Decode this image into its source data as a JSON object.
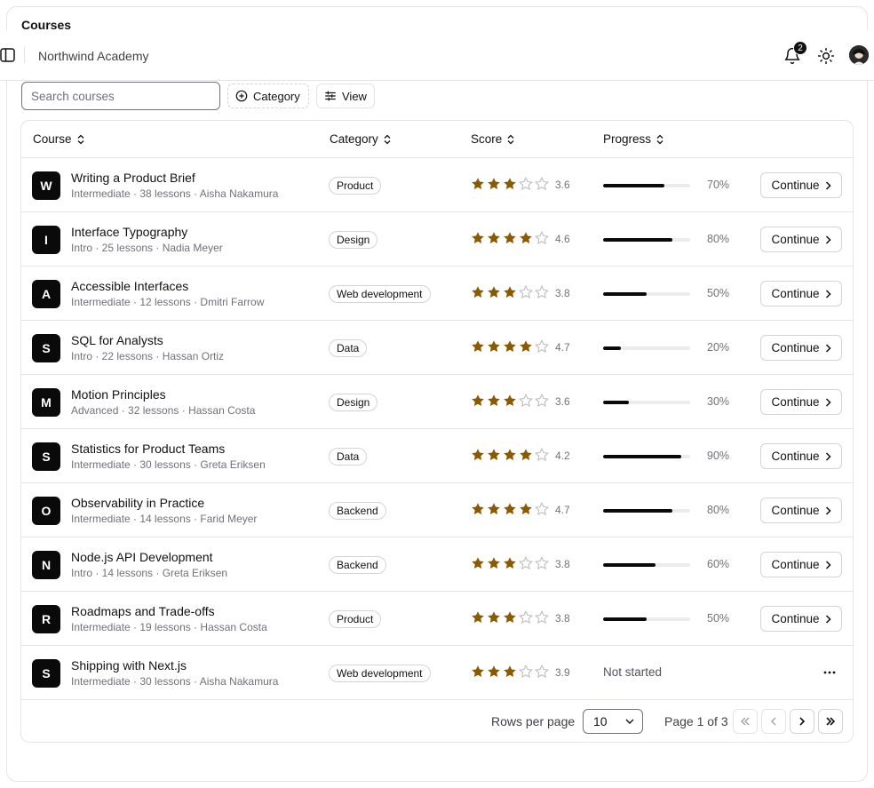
{
  "page": {
    "section_title": "Courses"
  },
  "topbar": {
    "brand": "Northwind Academy",
    "notification_count": "2"
  },
  "toolbar": {
    "search_placeholder": "Search courses",
    "category_filter_label": "Category",
    "view_label": "View"
  },
  "table": {
    "headers": {
      "course": "Course",
      "category": "Category",
      "score": "Score",
      "progress": "Progress"
    },
    "continue_label": "Continue",
    "not_started_label": "Not started",
    "rows": [
      {
        "initial": "W",
        "title": "Writing a Product Brief",
        "subtitle": "Intermediate · 38 lessons · Aisha Nakamura",
        "category": "Product",
        "stars": 3,
        "score": "3.6",
        "progress": 70,
        "progress_label": "70%",
        "started": true
      },
      {
        "initial": "I",
        "title": "Interface Typography",
        "subtitle": "Intro · 25 lessons · Nadia Meyer",
        "category": "Design",
        "stars": 4,
        "score": "4.6",
        "progress": 80,
        "progress_label": "80%",
        "started": true
      },
      {
        "initial": "A",
        "title": "Accessible Interfaces",
        "subtitle": "Intermediate · 12 lessons · Dmitri Farrow",
        "category": "Web development",
        "stars": 3,
        "score": "3.8",
        "progress": 50,
        "progress_label": "50%",
        "started": true
      },
      {
        "initial": "S",
        "title": "SQL for Analysts",
        "subtitle": "Intro · 22 lessons · Hassan Ortiz",
        "category": "Data",
        "stars": 4,
        "score": "4.7",
        "progress": 20,
        "progress_label": "20%",
        "started": true
      },
      {
        "initial": "M",
        "title": "Motion Principles",
        "subtitle": "Advanced · 32 lessons · Hassan Costa",
        "category": "Design",
        "stars": 3,
        "score": "3.6",
        "progress": 30,
        "progress_label": "30%",
        "started": true
      },
      {
        "initial": "S",
        "title": "Statistics for Product Teams",
        "subtitle": "Intermediate · 30 lessons · Greta Eriksen",
        "category": "Data",
        "stars": 4,
        "score": "4.2",
        "progress": 90,
        "progress_label": "90%",
        "started": true
      },
      {
        "initial": "O",
        "title": "Observability in Practice",
        "subtitle": "Intermediate · 14 lessons · Farid Meyer",
        "category": "Backend",
        "stars": 4,
        "score": "4.7",
        "progress": 80,
        "progress_label": "80%",
        "started": true
      },
      {
        "initial": "N",
        "title": "Node.js API Development",
        "subtitle": "Intro · 14 lessons · Greta Eriksen",
        "category": "Backend",
        "stars": 3,
        "score": "3.8",
        "progress": 60,
        "progress_label": "60%",
        "started": true
      },
      {
        "initial": "R",
        "title": "Roadmaps and Trade-offs",
        "subtitle": "Intermediate · 19 lessons · Hassan Costa",
        "category": "Product",
        "stars": 3,
        "score": "3.8",
        "progress": 50,
        "progress_label": "50%",
        "started": true
      },
      {
        "initial": "S",
        "title": "Shipping with Next.js",
        "subtitle": "Intermediate · 30 lessons · Aisha Nakamura",
        "category": "Web development",
        "stars": 3,
        "score": "3.9",
        "progress": 0,
        "progress_label": "",
        "started": false
      }
    ]
  },
  "pagination": {
    "rows_per_page_label": "Rows per page",
    "rows_per_page_value": "10",
    "page_label": "Page 1 of 3"
  },
  "colors": {
    "star_filled": "#8a5a00",
    "star_empty": "#bdbdc2",
    "accent": "#0a0a0a",
    "border": "#e4e4e7"
  }
}
